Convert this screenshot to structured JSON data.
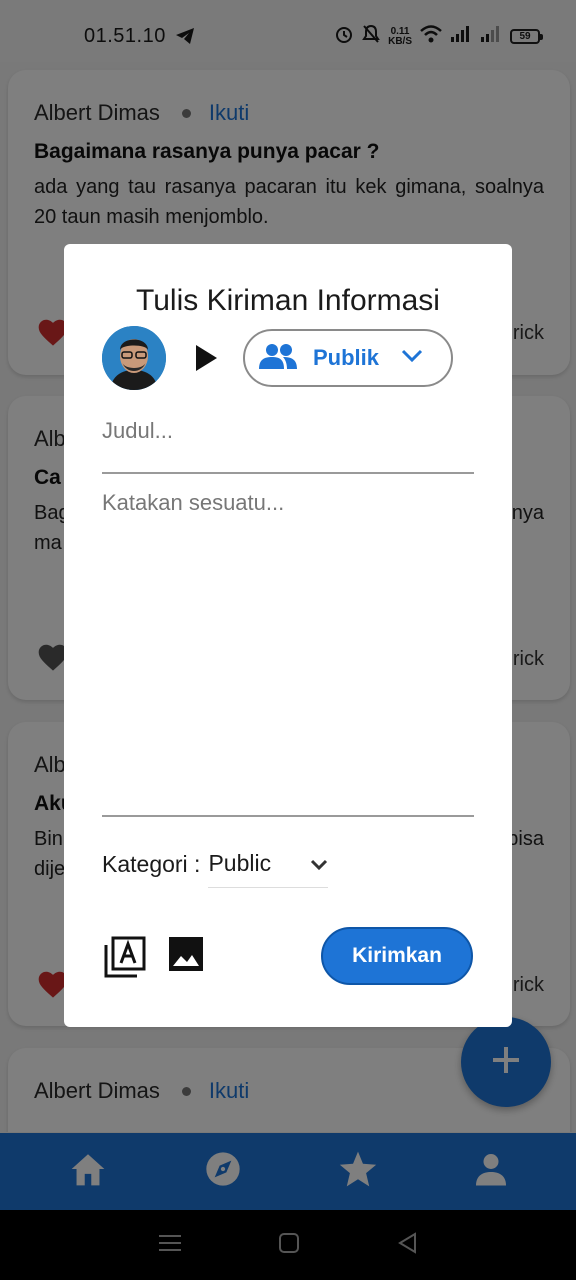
{
  "status_bar": {
    "time": "01.51.10",
    "net_speed": "0.11",
    "net_unit": "KB/S",
    "battery": "59"
  },
  "feed": {
    "cards": [
      {
        "author": "Albert Dimas",
        "follow": "Ikuti",
        "title": "Bagaimana rasanya punya pacar ?",
        "body": "ada yang tau rasanya pacaran itu kek gimana, soalnya 20 taun masih menjomblo.",
        "meta": "rick"
      },
      {
        "author": "Alb",
        "title": "Ca",
        "body_left": "Bag",
        "body_left2": "ma",
        "body_right": "nya",
        "meta": "rick"
      },
      {
        "author": "Alb",
        "title": "Aku",
        "body_left": "Bin",
        "body_left2": "dije",
        "body_right": "bisa",
        "meta": "rick"
      },
      {
        "author": "Albert Dimas",
        "follow": "Ikuti"
      }
    ]
  },
  "dialog": {
    "title": "Tulis Kiriman Informasi",
    "audience": "Publik",
    "title_placeholder": "Judul...",
    "body_placeholder": "Katakan sesuatu...",
    "category_label": "Kategori :",
    "category_value": "Public",
    "send_label": "Kirimkan"
  },
  "colors": {
    "accent": "#1e74d6",
    "heart_active": "#d32f2f",
    "heart_inactive": "#555555"
  },
  "icons": {
    "fab": "plus-icon",
    "nav": [
      "home-icon",
      "explore-icon",
      "star-icon",
      "person-icon"
    ]
  }
}
